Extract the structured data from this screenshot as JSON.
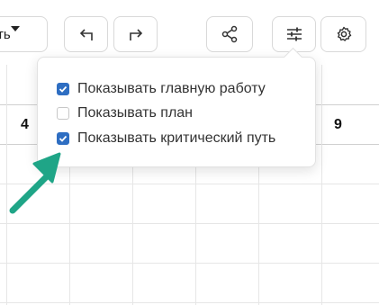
{
  "toolbar": {
    "view_label": "ть",
    "undo_icon": "undo-icon",
    "redo_icon": "redo-icon",
    "share_icon": "share-icon",
    "filter_icon": "sliders-icon",
    "settings_icon": "gear-icon"
  },
  "timeline": {
    "days": [
      "4",
      "9"
    ]
  },
  "display_options": {
    "items": [
      {
        "label": "Показывать главную работу",
        "checked": true
      },
      {
        "label": "Показывать план",
        "checked": false
      },
      {
        "label": "Показывать критический путь",
        "checked": true
      }
    ]
  },
  "colors": {
    "accent": "#2e6ec2",
    "annotation_arrow": "#1fa587"
  }
}
